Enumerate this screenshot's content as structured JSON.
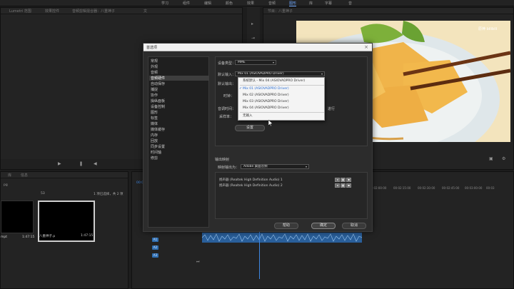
{
  "topbar": {
    "tabs": [
      "学习",
      "组件",
      "编辑",
      "颜色",
      "效果",
      "音频",
      "图形",
      "库",
      "字幕",
      "音"
    ],
    "active_index": 6
  },
  "left_panel": {
    "tabs": [
      "Lumetri 范围",
      "效果控件",
      "音频剪辑混合器：八重神子",
      "文"
    ]
  },
  "source_panel": {
    "title": "节目：八重神子"
  },
  "project_panel": {
    "tabs": [
      "库",
      "信息"
    ],
    "count": "53",
    "selection_info": "1 项已选择，共 2 项",
    "filename_left": "pg",
    "items": [
      {
        "name": "mpt",
        "duration": "1:47:15"
      },
      {
        "name": "八重神子.p",
        "duration": "1:47:15"
      }
    ]
  },
  "timeline": {
    "ruler": [
      "00:00",
      "00:02:00:00",
      "00:02:15:00",
      "00:02:30:00",
      "00:02:45:00",
      "00:03:00:00",
      "00:03"
    ],
    "tracks": [
      "A1",
      "A2",
      "A3"
    ],
    "timecode": "00:03"
  },
  "dialog": {
    "title": "首选项",
    "close": "×",
    "categories": [
      "常规",
      "外观",
      "音频",
      "音频硬件",
      "自动保存",
      "捕捉",
      "协作",
      "操纵面板",
      "设备控制",
      "图形",
      "标签",
      "媒体",
      "媒体缓存",
      "内存",
      "回放",
      "同步设置",
      "时间轴",
      "修剪"
    ],
    "selected_category_index": 3,
    "device_type_label": "设备类型：",
    "device_type_value": "MME",
    "default_input_label": "默认输入：",
    "default_input_value": "Mix 01 (ASIOVADPRO Driver)",
    "default_output_label": "默认输出：",
    "buffer_label": "时钟：",
    "latency_label": "音调时间：",
    "sample_rate_label": "采样率：",
    "hidden_suffix": "进行",
    "settings_button": "设置",
    "output_mapping_label": "输出映射",
    "map_output_label": "映射输出为：",
    "map_output_value": "Adobe 桌面音频",
    "output_rows": [
      "扬声器 (Realtek High Definition Audio) 1",
      "扬声器 (Realtek High Definition Audio) 2"
    ],
    "help_button": "帮助",
    "ok_button": "确定",
    "cancel_button": "取消"
  },
  "dropdown": {
    "items": [
      {
        "label": "系统默认 - Mix 04 (ASIOVADPRO Driver)",
        "checked": false
      },
      {
        "label": "Mix 01 (ASIOVADPRO Driver)",
        "checked": true
      },
      {
        "label": "Mix 02 (ASIOVADPRO Driver)",
        "checked": false
      },
      {
        "label": "Mix 03 (ASIOVADPRO Driver)",
        "checked": false
      },
      {
        "label": "Mix 04 (ASIOVADPRO Driver)",
        "checked": false
      },
      {
        "label": "无输入",
        "checked": false
      }
    ]
  },
  "watermark": {
    "text": "原神 bilibili"
  },
  "colors": {
    "accent": "#2b6fd6",
    "track": "#2f6fb2"
  }
}
